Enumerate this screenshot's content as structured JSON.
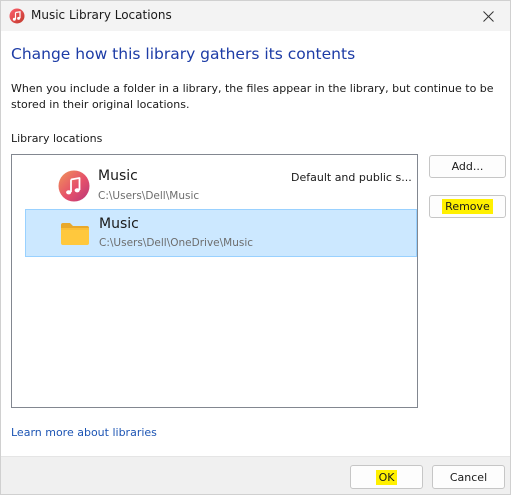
{
  "window": {
    "title": "Music Library Locations",
    "icon": "music-app-icon",
    "close_icon": "close-icon"
  },
  "heading": "Change how this library gathers its contents",
  "description": "When you include a folder in a library, the files appear in the library, but continue to be stored in their original locations.",
  "locations_label": "Library locations",
  "locations": [
    {
      "name": "Music",
      "path": "C:\\Users\\Dell\\Music",
      "status": "Default and public s...",
      "icon": "music-app-icon",
      "selected": false
    },
    {
      "name": "Music",
      "path": "C:\\Users\\Dell\\OneDrive\\Music",
      "status": "",
      "icon": "folder-icon",
      "selected": true
    }
  ],
  "buttons": {
    "add": "Add...",
    "remove": "Remove",
    "ok": "OK",
    "cancel": "Cancel"
  },
  "learn_more_link": "Learn more about libraries",
  "colors": {
    "heading": "#1d3ca6",
    "link": "#1d55b4",
    "selection_bg": "#cce8ff",
    "selection_border": "#99d1ff",
    "highlight": "#fff000"
  }
}
